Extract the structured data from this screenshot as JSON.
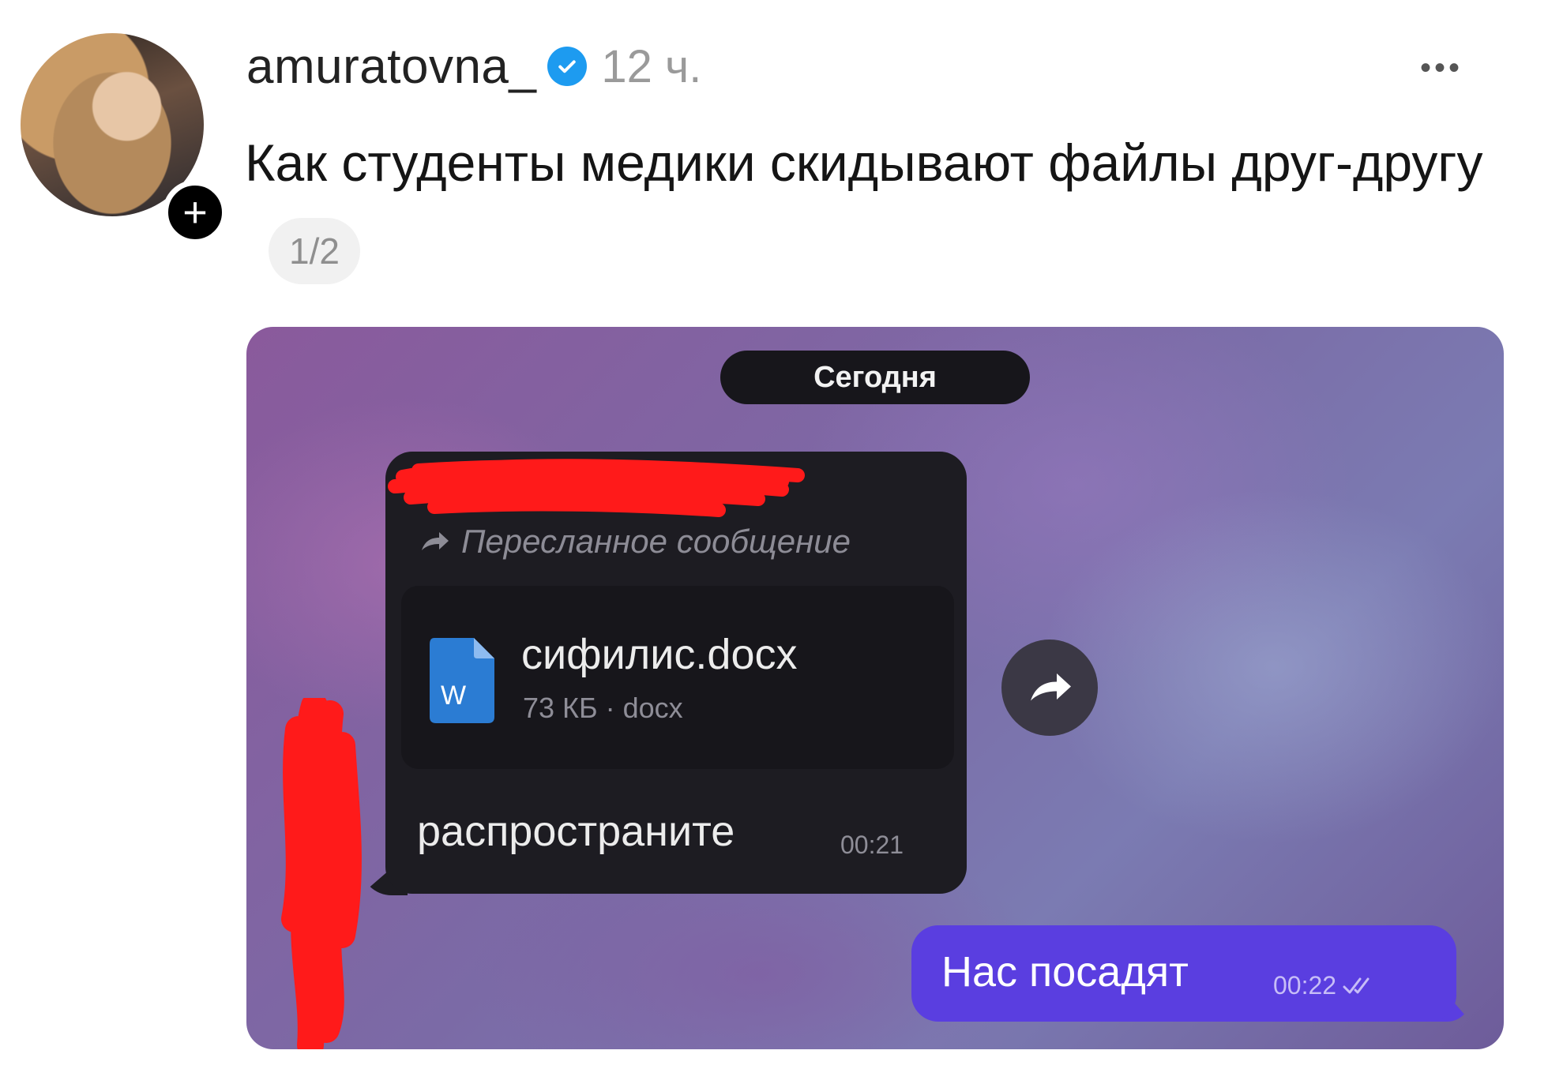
{
  "post": {
    "username": "amuratovna_",
    "time_ago": "12 ч.",
    "more": "•••",
    "text": "Как студенты медики скидывают файлы друг-другу",
    "page_indicator": "1/2",
    "follow_plus": "+"
  },
  "chat": {
    "date_separator": "Сегодня",
    "forwarded_label": "Пересланное сообщение",
    "file": {
      "icon_letter": "W",
      "name": "сифилис.docx",
      "meta": "73 КБ · docx"
    },
    "incoming_message": "распространите",
    "incoming_time": "00:21",
    "outgoing_message": "Нас посадят",
    "outgoing_time": "00:22"
  },
  "colors": {
    "verified_badge": "#1d9bf0",
    "outgoing_bubble": "#5a3ee0",
    "incoming_bubble": "#1d1c22",
    "redaction": "#ff1a1a",
    "word_icon": "#2b7cd3"
  },
  "icons": [
    "verified-badge-icon",
    "forward-arrow-icon",
    "word-file-icon",
    "share-icon",
    "double-check-icon",
    "more-icon",
    "plus-icon"
  ]
}
